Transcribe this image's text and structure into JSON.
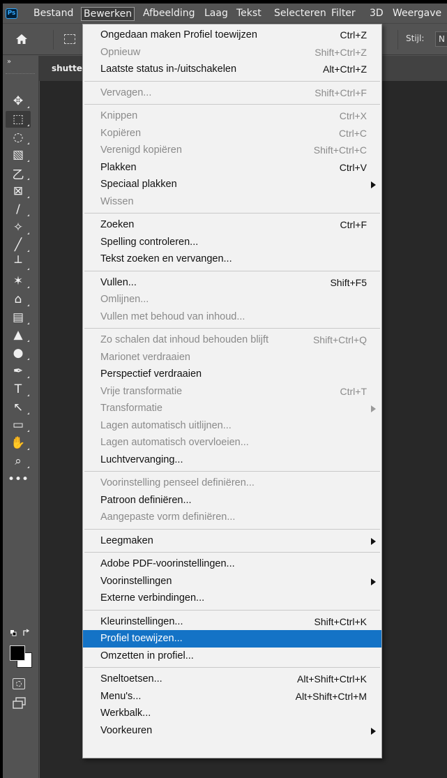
{
  "app": {
    "logo": "Ps",
    "menubar": [
      {
        "label": "Bestand",
        "active": false
      },
      {
        "label": "Bewerken",
        "active": true
      },
      {
        "label": "Afbeelding",
        "active": false
      },
      {
        "label": "Laag",
        "active": false
      },
      {
        "label": "Tekst",
        "active": false
      },
      {
        "label": "Selecteren",
        "active": false
      },
      {
        "label": "Filter",
        "active": false
      },
      {
        "label": "3D",
        "active": false
      },
      {
        "label": "Weergave",
        "active": false
      }
    ],
    "options": {
      "style_label": "Stijl:",
      "style_value": "N"
    },
    "document_tab": "shutte",
    "panel_collapse": "»"
  },
  "menu": {
    "groups": [
      [
        {
          "label": "Ongedaan maken Profiel toewijzen",
          "shortcut": "Ctrl+Z",
          "enabled": true
        },
        {
          "label": "Opnieuw",
          "shortcut": "Shift+Ctrl+Z",
          "enabled": false
        },
        {
          "label": "Laatste status in-/uitschakelen",
          "shortcut": "Alt+Ctrl+Z",
          "enabled": true
        }
      ],
      [
        {
          "label": "Vervagen...",
          "shortcut": "Shift+Ctrl+F",
          "enabled": false
        }
      ],
      [
        {
          "label": "Knippen",
          "shortcut": "Ctrl+X",
          "enabled": false
        },
        {
          "label": "Kopiëren",
          "shortcut": "Ctrl+C",
          "enabled": false
        },
        {
          "label": "Verenigd kopiëren",
          "shortcut": "Shift+Ctrl+C",
          "enabled": false
        },
        {
          "label": "Plakken",
          "shortcut": "Ctrl+V",
          "enabled": true
        },
        {
          "label": "Speciaal plakken",
          "shortcut": "",
          "enabled": true,
          "submenu": true
        },
        {
          "label": "Wissen",
          "shortcut": "",
          "enabled": false
        }
      ],
      [
        {
          "label": "Zoeken",
          "shortcut": "Ctrl+F",
          "enabled": true
        },
        {
          "label": "Spelling controleren...",
          "shortcut": "",
          "enabled": true
        },
        {
          "label": "Tekst zoeken en vervangen...",
          "shortcut": "",
          "enabled": true
        }
      ],
      [
        {
          "label": "Vullen...",
          "shortcut": "Shift+F5",
          "enabled": true
        },
        {
          "label": "Omlijnen...",
          "shortcut": "",
          "enabled": false
        },
        {
          "label": "Vullen met behoud van inhoud...",
          "shortcut": "",
          "enabled": false
        }
      ],
      [
        {
          "label": "Zo schalen dat inhoud behouden blijft",
          "shortcut": "Shift+Ctrl+Q",
          "enabled": false
        },
        {
          "label": "Marionet verdraaien",
          "shortcut": "",
          "enabled": false
        },
        {
          "label": "Perspectief verdraaien",
          "shortcut": "",
          "enabled": true
        },
        {
          "label": "Vrije transformatie",
          "shortcut": "Ctrl+T",
          "enabled": false
        },
        {
          "label": "Transformatie",
          "shortcut": "",
          "enabled": false,
          "submenu": true
        },
        {
          "label": "Lagen automatisch uitlijnen...",
          "shortcut": "",
          "enabled": false
        },
        {
          "label": "Lagen automatisch overvloeien...",
          "shortcut": "",
          "enabled": false
        },
        {
          "label": "Luchtvervanging...",
          "shortcut": "",
          "enabled": true
        }
      ],
      [
        {
          "label": "Voorinstelling penseel definiëren...",
          "shortcut": "",
          "enabled": false
        },
        {
          "label": "Patroon definiëren...",
          "shortcut": "",
          "enabled": true
        },
        {
          "label": "Aangepaste vorm definiëren...",
          "shortcut": "",
          "enabled": false
        }
      ],
      [
        {
          "label": "Leegmaken",
          "shortcut": "",
          "enabled": true,
          "submenu": true
        }
      ],
      [
        {
          "label": "Adobe PDF-voorinstellingen...",
          "shortcut": "",
          "enabled": true
        },
        {
          "label": "Voorinstellingen",
          "shortcut": "",
          "enabled": true,
          "submenu": true
        },
        {
          "label": "Externe verbindingen...",
          "shortcut": "",
          "enabled": true
        }
      ],
      [
        {
          "label": "Kleurinstellingen...",
          "shortcut": "Shift+Ctrl+K",
          "enabled": true
        },
        {
          "label": "Profiel toewijzen...",
          "shortcut": "",
          "enabled": true,
          "highlighted": true
        },
        {
          "label": "Omzetten in profiel...",
          "shortcut": "",
          "enabled": true
        }
      ],
      [
        {
          "label": "Sneltoetsen...",
          "shortcut": "Alt+Shift+Ctrl+K",
          "enabled": true
        },
        {
          "label": "Menu's...",
          "shortcut": "Alt+Shift+Ctrl+M",
          "enabled": true
        },
        {
          "label": "Werkbalk...",
          "shortcut": "",
          "enabled": true
        },
        {
          "label": "Voorkeuren",
          "shortcut": "",
          "enabled": true,
          "submenu": true
        }
      ]
    ]
  },
  "tools": [
    {
      "name": "move-tool-icon",
      "glyph": "✥"
    },
    {
      "name": "rectangular-marquee-tool-icon",
      "glyph": "⬚",
      "selected": true
    },
    {
      "name": "lasso-tool-icon",
      "glyph": "◌"
    },
    {
      "name": "object-selection-tool-icon",
      "glyph": "▧"
    },
    {
      "name": "crop-tool-icon",
      "glyph": "⼄"
    },
    {
      "name": "frame-tool-icon",
      "glyph": "⊠"
    },
    {
      "name": "eyedropper-tool-icon",
      "glyph": "∕"
    },
    {
      "name": "healing-brush-tool-icon",
      "glyph": "✧"
    },
    {
      "name": "brush-tool-icon",
      "glyph": "╱"
    },
    {
      "name": "clone-stamp-tool-icon",
      "glyph": "┴"
    },
    {
      "name": "history-brush-tool-icon",
      "glyph": "✶"
    },
    {
      "name": "eraser-tool-icon",
      "glyph": "⌂"
    },
    {
      "name": "gradient-tool-icon",
      "glyph": "▤"
    },
    {
      "name": "blur-tool-icon",
      "glyph": "▲"
    },
    {
      "name": "dodge-tool-icon",
      "glyph": "●"
    },
    {
      "name": "pen-tool-icon",
      "glyph": "✒"
    },
    {
      "name": "type-tool-icon",
      "glyph": "T"
    },
    {
      "name": "path-selection-tool-icon",
      "glyph": "↖"
    },
    {
      "name": "rectangle-tool-icon",
      "glyph": "▭"
    },
    {
      "name": "hand-tool-icon",
      "glyph": "✋"
    },
    {
      "name": "zoom-tool-icon",
      "glyph": "⌕"
    },
    {
      "name": "edit-toolbar-icon",
      "glyph": "•••"
    }
  ],
  "colors": {
    "menu_bg": "#f2f2f2",
    "menu_highlight": "#1473c6",
    "ui_panel": "#535353",
    "canvas": "#282828",
    "foreground_color": "#000000",
    "background_color": "#ffffff"
  }
}
